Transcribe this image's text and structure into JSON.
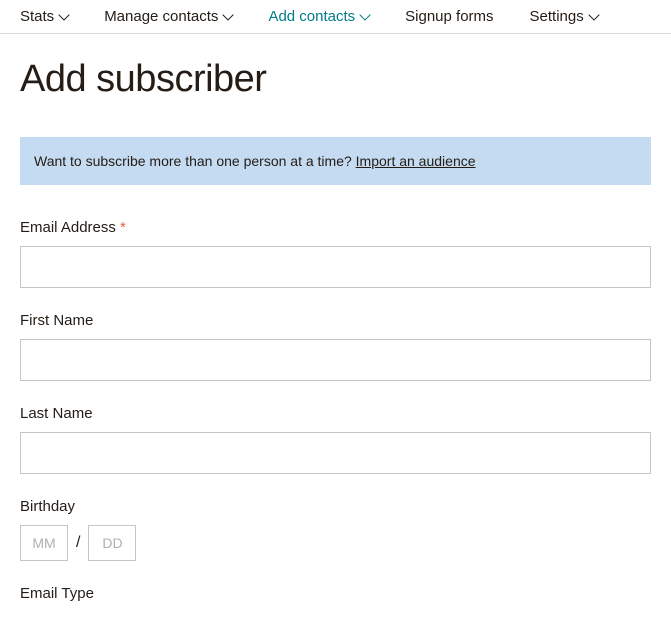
{
  "nav": {
    "items": [
      {
        "label": "Stats",
        "hasDropdown": true,
        "active": false
      },
      {
        "label": "Manage contacts",
        "hasDropdown": true,
        "active": false
      },
      {
        "label": "Add contacts",
        "hasDropdown": true,
        "active": true
      },
      {
        "label": "Signup forms",
        "hasDropdown": false,
        "active": false
      },
      {
        "label": "Settings",
        "hasDropdown": true,
        "active": false
      }
    ]
  },
  "page": {
    "title": "Add subscriber"
  },
  "banner": {
    "text": "Want to subscribe more than one person at a time? ",
    "link": "Import an audience"
  },
  "fields": {
    "email": {
      "label": "Email Address",
      "required": "*",
      "value": ""
    },
    "firstName": {
      "label": "First Name",
      "value": ""
    },
    "lastName": {
      "label": "Last Name",
      "value": ""
    },
    "birthday": {
      "label": "Birthday",
      "month": {
        "placeholder": "MM",
        "value": ""
      },
      "day": {
        "placeholder": "DD",
        "value": ""
      },
      "separator": "/"
    },
    "emailType": {
      "label": "Email Type"
    }
  }
}
